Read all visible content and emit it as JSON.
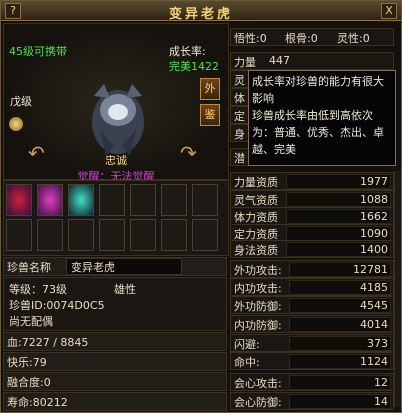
{
  "window": {
    "title": "变异老虎",
    "help_label": "?",
    "close_label": "X"
  },
  "pet": {
    "carry_level": "45级可携带",
    "growth_label": "成长率:",
    "growth_value": "完美1422",
    "rank": "戊级",
    "loyalty": "忠诚",
    "awaken": "觉醒：无法觉醒",
    "outer_btn": "外",
    "appraise_btn": "鉴"
  },
  "top_attrs": {
    "wuxing": "悟性:0",
    "gengu": "根骨:0",
    "lingxing": "灵性:0"
  },
  "left_attrs": [
    {
      "label": "力量",
      "value": "447"
    },
    {
      "label": "灵",
      "value": ""
    },
    {
      "label": "体",
      "value": ""
    },
    {
      "label": "定",
      "value": ""
    },
    {
      "label": "身",
      "value": ""
    },
    {
      "label": "潜",
      "value": ""
    }
  ],
  "tooltip": {
    "text": "成长率对珍兽的能力有很大影响\n珍兽成长率由低到高依次为：普通、优秀、杰出、卓越、完美"
  },
  "aptitudes": [
    {
      "label": "力量资质",
      "value": "1977"
    },
    {
      "label": "灵气资质",
      "value": "1088"
    },
    {
      "label": "体力资质",
      "value": "1662"
    },
    {
      "label": "定力资质",
      "value": "1090"
    },
    {
      "label": "身法资质",
      "value": "1400"
    }
  ],
  "name_row": {
    "label": "珍兽名称",
    "value": "变异老虎"
  },
  "info": {
    "level": "等级：73级",
    "gender": "雄性",
    "id": "珍兽ID:0074D0C5",
    "mate": "尚无配偶"
  },
  "bottom_rows": [
    {
      "label": "血:7227 / 8845"
    },
    {
      "label": "快乐:79"
    },
    {
      "label": "融合度:0"
    },
    {
      "label": "寿命:80212"
    }
  ],
  "combat": [
    {
      "label": "外功攻击:",
      "value": "12781"
    },
    {
      "label": "内功攻击:",
      "value": "4185"
    },
    {
      "label": "外功防御:",
      "value": "4545"
    },
    {
      "label": "内功防御:",
      "value": "4014"
    },
    {
      "label": "闪避:",
      "value": "373"
    },
    {
      "label": "命中:",
      "value": "1124"
    },
    {
      "label": "会心攻击:",
      "value": "12"
    },
    {
      "label": "会心防御:",
      "value": "14"
    }
  ],
  "colors": {
    "accent": "#f2d47a",
    "green": "#4fe04f",
    "purple": "#d040d0"
  }
}
